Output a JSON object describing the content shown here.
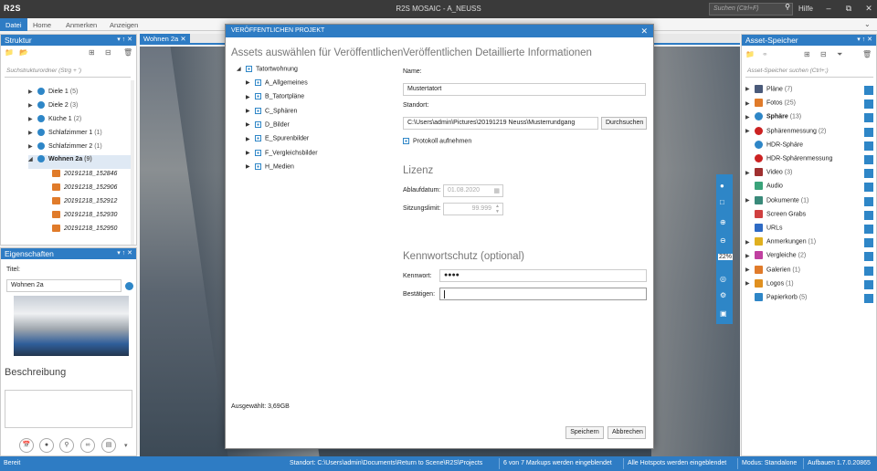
{
  "app": {
    "logo": "R2S",
    "title": "R2S MOSAIC - A_NEUSS",
    "search_placeholder": "Suchen (Ctrl+F)",
    "help": "Hilfe"
  },
  "menu": [
    "Datei",
    "Home",
    "Anmerken",
    "Anzeigen"
  ],
  "struktur": {
    "title": "Struktur",
    "search_placeholder": "Suchstrukturordner (Strg + ')",
    "items": [
      {
        "label": "Diele 1",
        "count": "(5)"
      },
      {
        "label": "Diele 2",
        "count": "(3)"
      },
      {
        "label": "Küche 1",
        "count": "(2)"
      },
      {
        "label": "Schlafzimmer 1",
        "count": "(1)"
      },
      {
        "label": "Schlafzimmer 2",
        "count": "(1)"
      },
      {
        "label": "Wohnen 2a",
        "count": "(9)"
      }
    ],
    "photos": [
      "20191218_152846",
      "20191218_152906",
      "20191218_152912",
      "20191218_152930",
      "20191218_152950"
    ]
  },
  "eigenschaften": {
    "title": "Eigenschaften",
    "titel_label": "Titel:",
    "titel_value": "Wohnen 2a",
    "beschreibung": "Beschreibung"
  },
  "center": {
    "tab": "Wohnen 2a",
    "zoom": "22%"
  },
  "assets": {
    "title": "Asset-Speicher",
    "search_placeholder": "Asset-Speicher suchen (Ctrl+;)",
    "items": [
      {
        "label": "Pläne",
        "count": "(7)",
        "color": "#4a5a7a",
        "expand": true
      },
      {
        "label": "Fotos",
        "count": "(25)",
        "color": "#e07b2a",
        "expand": true
      },
      {
        "label": "Sphäre",
        "count": "(13)",
        "color": "#2e86c7",
        "expand": true,
        "bold": true
      },
      {
        "label": "Sphärenmessung",
        "count": "(2)",
        "color": "#cc2222",
        "expand": true
      },
      {
        "label": "HDR-Sphäre",
        "count": "",
        "color": "#2e86c7",
        "expand": false
      },
      {
        "label": "HDR-Sphärenmessung",
        "count": "",
        "color": "#cc2222",
        "expand": false
      },
      {
        "label": "Video",
        "count": "(3)",
        "color": "#a03030",
        "expand": true
      },
      {
        "label": "Audio",
        "count": "",
        "color": "#3aa37a",
        "expand": false
      },
      {
        "label": "Dokumente",
        "count": "(1)",
        "color": "#3a8a7a",
        "expand": true
      },
      {
        "label": "Screen Grabs",
        "count": "",
        "color": "#d04040",
        "expand": false
      },
      {
        "label": "URLs",
        "count": "",
        "color": "#2e6ac4",
        "expand": false
      },
      {
        "label": "Anmerkungen",
        "count": "(1)",
        "color": "#e0b020",
        "expand": true
      },
      {
        "label": "Vergleiche",
        "count": "(2)",
        "color": "#c040a0",
        "expand": true
      },
      {
        "label": "Galerien",
        "count": "(1)",
        "color": "#e07b2a",
        "expand": true
      },
      {
        "label": "Logos",
        "count": "(1)",
        "color": "#e09020",
        "expand": true
      },
      {
        "label": "Papierkorb",
        "count": "(5)",
        "color": "#2e86c7",
        "expand": false
      }
    ]
  },
  "modal": {
    "title": "VERÖFFENTLICHEN PROJEKT",
    "left_heading": "Assets auswählen für Veröffentlichen",
    "right_heading": "Veröffentlichen Detaillierte Informationen",
    "tree_root": "Tatortwohnung",
    "tree_items": [
      "A_Allgemeines",
      "B_Tatortpläne",
      "C_Sphären",
      "D_Bilder",
      "E_Spurenbilder",
      "F_Vergleichsbilder",
      "H_Medien"
    ],
    "name_label": "Name:",
    "name_value": "Mustertatort",
    "standort_label": "Standort:",
    "standort_value": "C:\\Users\\admin\\Pictures\\20191219 Neuss\\Musterrundgang",
    "browse": "Durchsuchen",
    "protokoll": "Protokoll aufnehmen",
    "lizenz_heading": "Lizenz",
    "ablauf_label": "Ablaufdatum:",
    "ablauf_value": "01.08.2020",
    "sitzung_label": "Sitzungslimit:",
    "sitzung_value": "99.999",
    "pw_heading": "Kennwortschutz (optional)",
    "kennwort_label": "Kennwort:",
    "kennwort_value": "●●●●",
    "bestaetigen_label": "Bestätigen:",
    "selected": "Ausgewählt: 3,69GB",
    "save": "Speichern",
    "cancel": "Abbrechen"
  },
  "status": {
    "left": "Bereit",
    "standort": "Standort: C:\\Users\\admin\\Documents\\Return to Scene\\R2S\\Projects",
    "markups": "6 von 7 Markups werden eingeblendet",
    "hotspots": "Alle Hotspots werden eingeblendet",
    "modus": "Modus: Standalone",
    "build": "Aufbauen 1.7.0.20865"
  }
}
